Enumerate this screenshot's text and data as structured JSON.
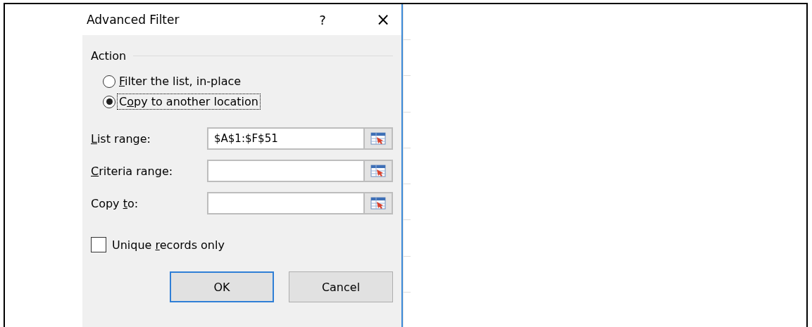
{
  "dialog": {
    "title": "Advanced Filter",
    "help": "?",
    "close": "×"
  },
  "action": {
    "legend": "Action",
    "options": [
      {
        "key": "F",
        "after": "ilter the list, in-place",
        "selected": false,
        "focused": false
      },
      {
        "before": "C",
        "key": "o",
        "after": "py to another location",
        "selected": true,
        "focused": true
      }
    ]
  },
  "fields": [
    {
      "key": "L",
      "after": "ist range:",
      "value": "$A$1:$F$51"
    },
    {
      "key": "C",
      "after": "riteria range:"
    },
    {
      "before": "Copy ",
      "key": "t",
      "after": "o:"
    }
  ],
  "unique": {
    "before": "Unique ",
    "key": "r",
    "after": "ecords only",
    "checked": false
  },
  "buttons": [
    {
      "label": "OK",
      "default": true
    },
    {
      "label": "Cancel",
      "default": false
    }
  ]
}
